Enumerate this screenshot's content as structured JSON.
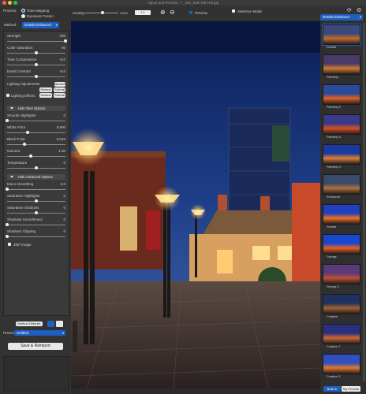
{
  "title": "Adjust and Preview — _MG_8087Hdr.Hdr.jpg",
  "process": {
    "label": "Process:",
    "options": [
      "Tone Mapping",
      "Exposure Fusion"
    ],
    "selected": "Tone Mapping"
  },
  "method": {
    "label": "Method:",
    "value": "Details Enhancer"
  },
  "scaling": {
    "label": "Scaling:",
    "value": "1:1",
    "zoom_label": "100%"
  },
  "preview_label": "Preview",
  "selection_mode_label": "Selection Mode",
  "presets_dropdown": "Details Enhancer",
  "sliders": [
    {
      "label": "Strength",
      "value": "100",
      "level": 1.0
    },
    {
      "label": "Color Saturation",
      "value": "50",
      "level": 0.5
    },
    {
      "label": "Tone Compression",
      "value": "-5,0",
      "level": 0.5
    },
    {
      "label": "Detail Contrast",
      "value": "-5,0",
      "level": 0.5
    }
  ],
  "lighting": {
    "label": "Lighting Adjustments",
    "buttons": [
      "Medium",
      "Natural",
      "Surreal",
      "Natural +",
      "Surreal +"
    ],
    "effects_label": "Lighting Effects"
  },
  "white_options": {
    "header": "Hide Tone Options",
    "sliders": [
      {
        "label": "Smooth Highlights",
        "value": "0",
        "level": 0.0
      },
      {
        "label": "White Point",
        "value": "0,500",
        "level": 0.35
      },
      {
        "label": "Black Point",
        "value": "0,010",
        "level": 0.3
      },
      {
        "label": "Gamma",
        "value": "1,30",
        "level": 0.4
      },
      {
        "label": "Temperature",
        "value": "0",
        "level": 0.5
      }
    ]
  },
  "advanced_options": {
    "header": "Hide Advanced Options",
    "sliders": [
      {
        "label": "Micro-smoothing",
        "value": "0,0",
        "level": 0.0
      },
      {
        "label": "Saturation Highlights",
        "value": "0",
        "level": 0.5
      },
      {
        "label": "Saturation Shadows",
        "value": "0",
        "level": 0.5
      },
      {
        "label": "Shadows Smoothness",
        "value": "0",
        "level": 0.0
      },
      {
        "label": "Shadows Clipping",
        "value": "0",
        "level": 0.0
      }
    ],
    "checkbox_360": "360º image"
  },
  "method_defaults_label": "Method Defaults",
  "preset": {
    "label": "Preset:",
    "value": "Untitled"
  },
  "save_button": "Save & Reimport",
  "thumbnails": [
    {
      "caption": "Default",
      "colors": [
        "#3b4a7a",
        "#c46a2a"
      ]
    },
    {
      "caption": "Painterly",
      "colors": [
        "#4a3a6a",
        "#d07a30"
      ]
    },
    {
      "caption": "Painterly 2",
      "colors": [
        "#2a4a9a",
        "#e06020"
      ]
    },
    {
      "caption": "Painterly 3",
      "colors": [
        "#3a3a8a",
        "#d85020"
      ]
    },
    {
      "caption": "Painterly 4",
      "colors": [
        "#1a3aa0",
        "#e08030"
      ]
    },
    {
      "caption": "Enhanced",
      "colors": [
        "#3a4a6a",
        "#b07040"
      ]
    },
    {
      "caption": "Surreal",
      "colors": [
        "#2040c0",
        "#f07020"
      ]
    },
    {
      "caption": "Grunge",
      "colors": [
        "#1848d0",
        "#e86020"
      ]
    },
    {
      "caption": "Grunge 2",
      "colors": [
        "#5a3a7a",
        "#c05030"
      ]
    },
    {
      "caption": "Creative",
      "colors": [
        "#203060",
        "#a06030"
      ]
    },
    {
      "caption": "Creative 2",
      "colors": [
        "#2a3080",
        "#d06830"
      ]
    },
    {
      "caption": "Creative 3",
      "colors": [
        "#3050c0",
        "#e07828"
      ]
    }
  ],
  "tabs": [
    "Built-In",
    "My Presets"
  ],
  "colors": {
    "accent": "#1f5fbf",
    "panel": "#3a3a3a",
    "background": "#2b2b2b"
  }
}
